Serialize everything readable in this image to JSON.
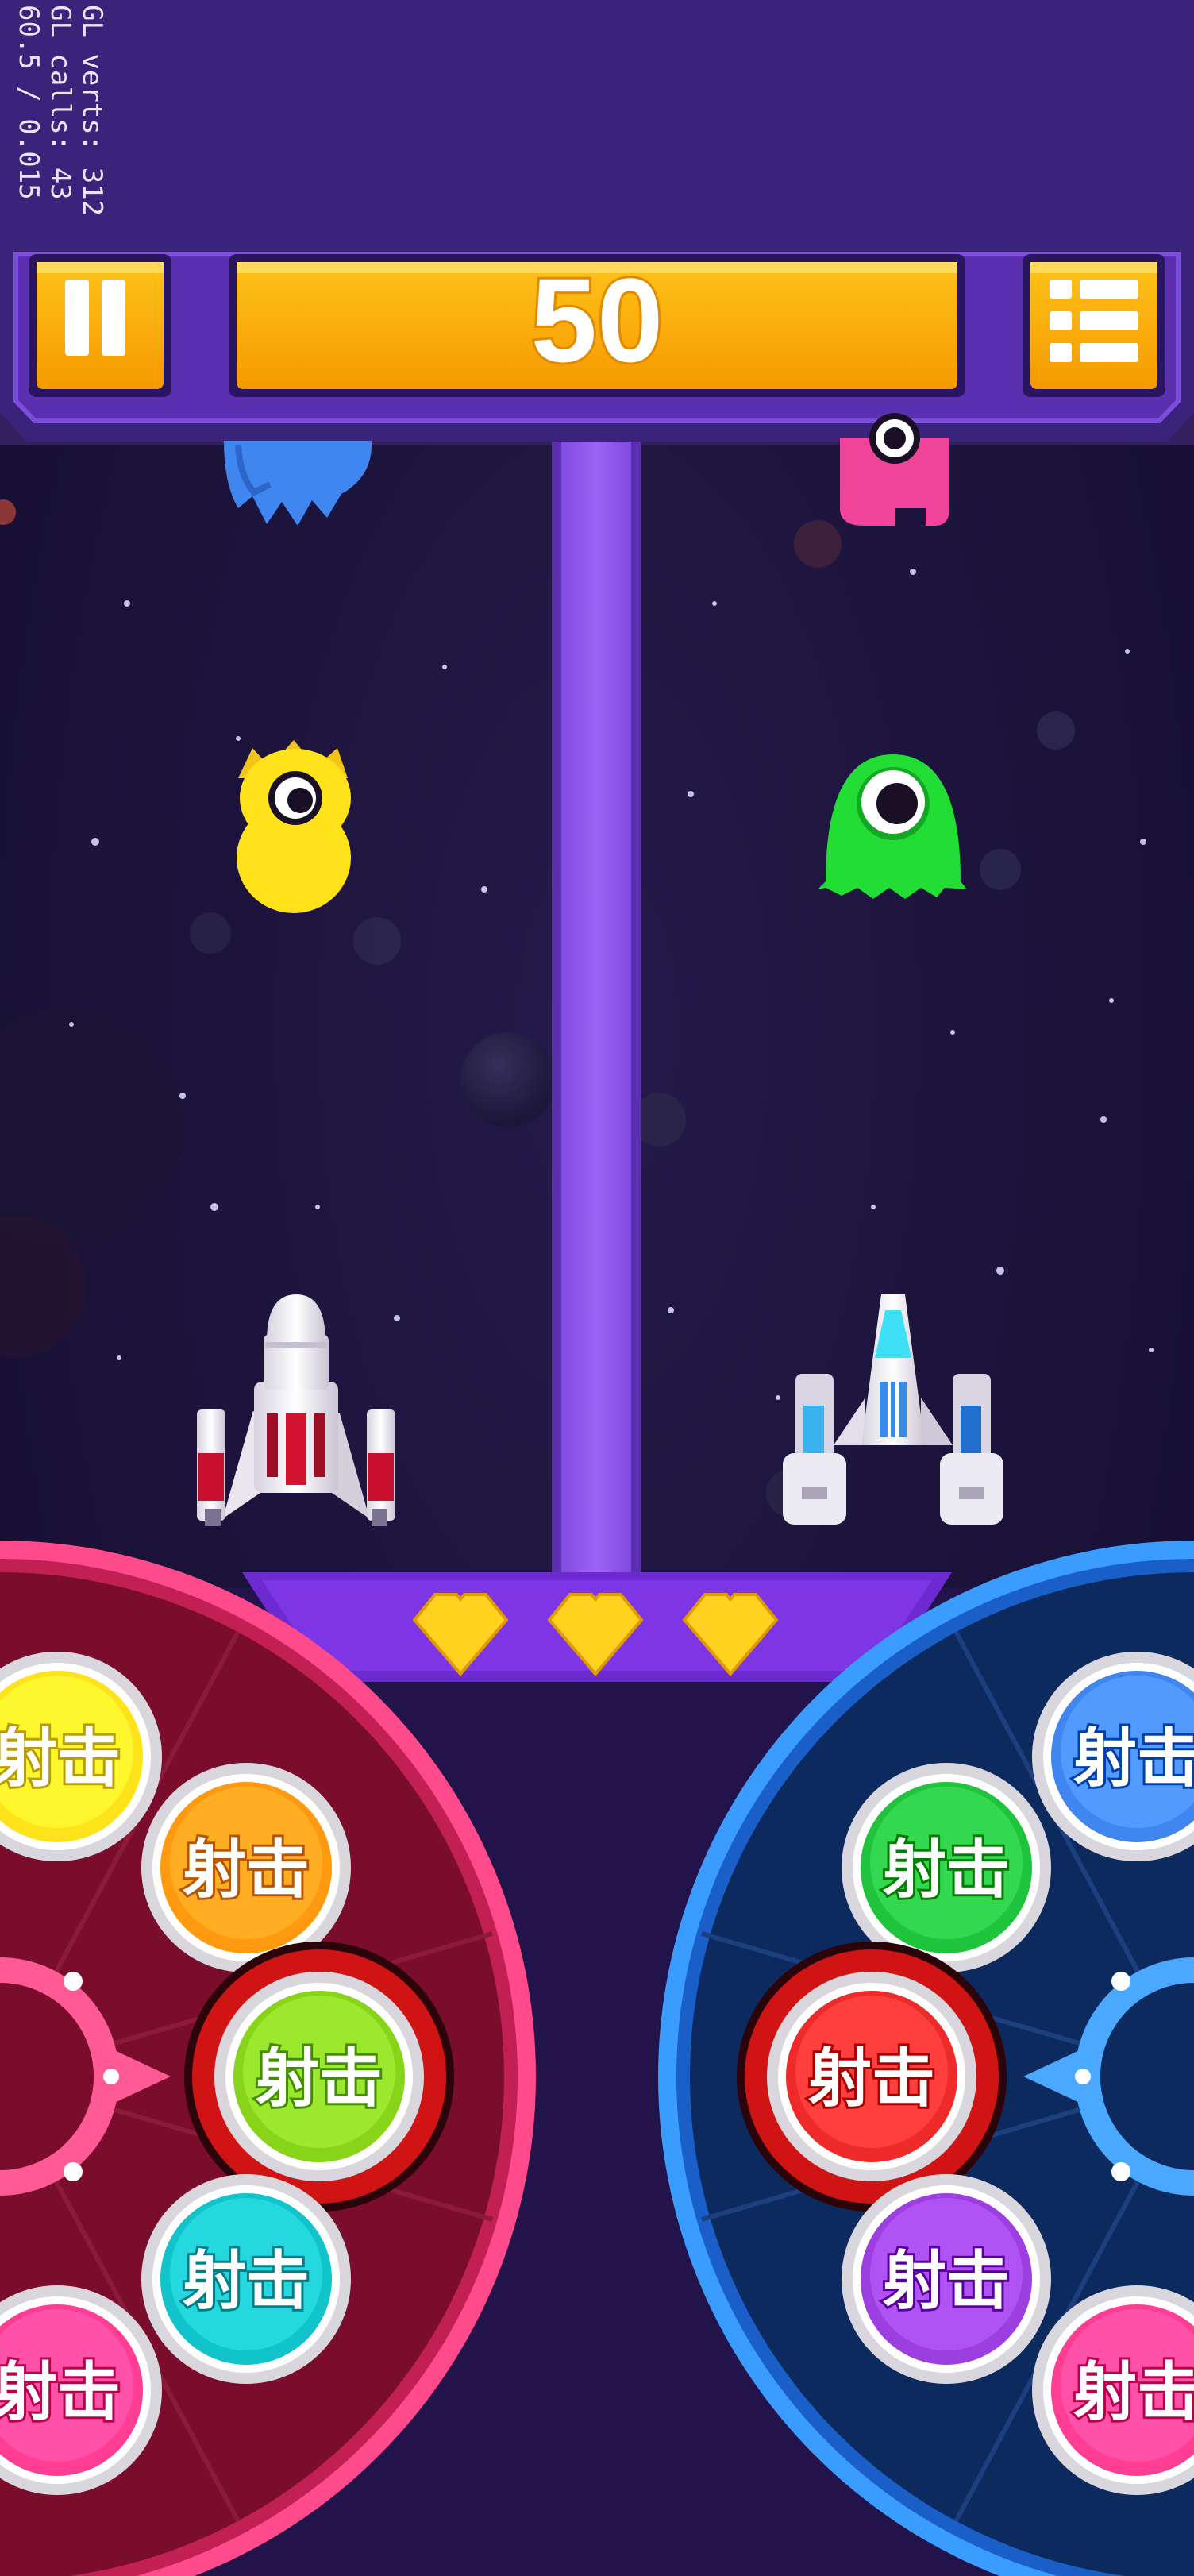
{
  "debug": {
    "gl_verts": "GL verts:   312",
    "gl_calls": "GL calls:    43",
    "fps": "60.5 / 0.015"
  },
  "header": {
    "score": "50",
    "pause_icon": "pause-icon",
    "menu_icon": "menu-list-icon"
  },
  "lives": {
    "count": 3,
    "icon": "heart-icon",
    "color": "#ffd21f"
  },
  "enemies": [
    {
      "name": "blue-spiky-alien",
      "color": "#3f86f0"
    },
    {
      "name": "pink-cyclops-alien",
      "color": "#f0449a"
    },
    {
      "name": "yellow-crowned-alien",
      "color": "#ffe21a"
    },
    {
      "name": "green-slime-alien",
      "color": "#22dd33"
    }
  ],
  "ships": {
    "left": "red-striped-fighter-ship",
    "right": "blue-cockpit-fighter-ship"
  },
  "left_controller": {
    "ring_color": "#ff4a8c",
    "buttons": [
      {
        "label": "射击",
        "color": "#ffe31a",
        "name": "fire-button-yellow"
      },
      {
        "label": "射击",
        "color": "#ff9a10",
        "name": "fire-button-orange"
      },
      {
        "label": "射击",
        "color": "#88d418",
        "name": "fire-button-lime",
        "selected": true
      },
      {
        "label": "射击",
        "color": "#11c4cc",
        "name": "fire-button-cyan"
      },
      {
        "label": "射击",
        "color": "#ff3d93",
        "name": "fire-button-pink"
      }
    ]
  },
  "right_controller": {
    "ring_color": "#3b9cff",
    "buttons": [
      {
        "label": "射击",
        "color": "#3f86f0",
        "name": "fire-button-blue"
      },
      {
        "label": "射击",
        "color": "#1fc43c",
        "name": "fire-button-green"
      },
      {
        "label": "射击",
        "color": "#ee2a2a",
        "name": "fire-button-red",
        "selected": true
      },
      {
        "label": "射击",
        "color": "#9d3fe0",
        "name": "fire-button-purple"
      },
      {
        "label": "射击",
        "color": "#ff3d93",
        "name": "fire-button-pink"
      }
    ]
  }
}
